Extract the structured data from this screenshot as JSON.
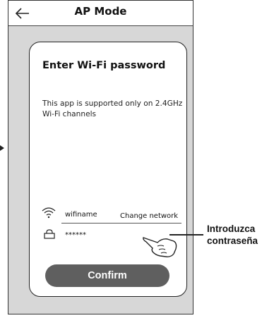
{
  "header": {
    "title": "AP Mode",
    "back_icon": "back-arrow-icon"
  },
  "card": {
    "title": "Enter Wi-Fi password",
    "description": "This app is supported only on 2.4GHz Wi-Fi channels",
    "wifi": {
      "icon": "wifi-icon",
      "name": "wifiname",
      "change_label": "Change network"
    },
    "password": {
      "icon": "lock-icon",
      "value": "******"
    },
    "confirm_label": "Confirm"
  },
  "callout": {
    "text": "Introduzca contraseña"
  }
}
